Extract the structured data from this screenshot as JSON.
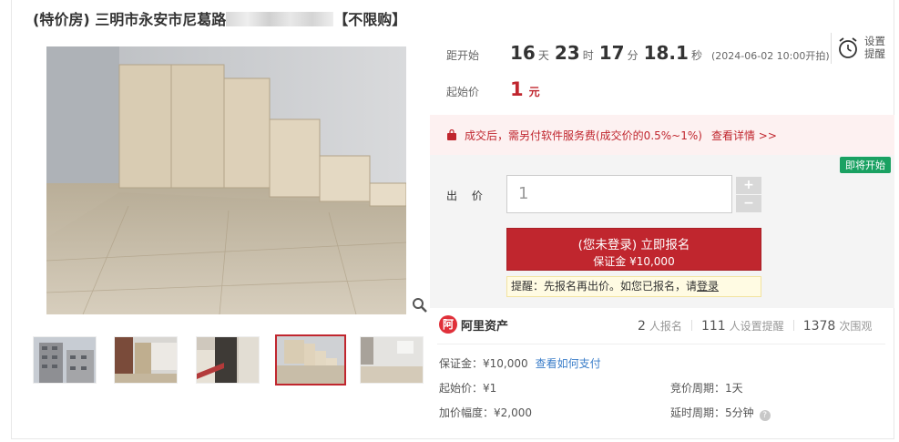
{
  "title": {
    "prefix": "(特价房) 三明市永安市尼葛路",
    "suffix": "【不限购】"
  },
  "countdown": {
    "label": "距开始",
    "days": "16",
    "days_unit": "天",
    "hours": "23",
    "hours_unit": "时",
    "minutes": "17",
    "minutes_unit": "分",
    "seconds": "18.1",
    "seconds_unit": "秒",
    "start_note": "(2024-06-02 10:00开拍)"
  },
  "reminder": {
    "label": "设置提醒",
    "icon": "alarm-clock-icon"
  },
  "start_price": {
    "label": "起始价",
    "value": "1",
    "unit": "元"
  },
  "fee_notice": {
    "text": "成交后，需另付软件服务费(成交价的0.5%~1%)",
    "link": "查看详情 >>"
  },
  "bid": {
    "badge": "即将开始",
    "label": "出 价",
    "value": "1",
    "plus": "+",
    "minus": "−",
    "signup_line1": "(您未登录) 立即报名",
    "signup_line2": "保证金 ¥10,000",
    "tip_text": "提醒：先报名再出价。如您已报名，请",
    "tip_link": "登录"
  },
  "platform": {
    "logo_char": "阿",
    "name": "阿里资产"
  },
  "stats": {
    "signups_num": "2",
    "signups_label": "人报名",
    "reminders_num": "111",
    "reminders_label": "人设置提醒",
    "views_num": "1378",
    "views_label": "次围观"
  },
  "details": {
    "deposit": "保证金：¥10,000",
    "how_to_pay": "查看如何支付",
    "start_price": "起始价：¥1",
    "cycle": "竞价周期：1天",
    "increment": "加价幅度：¥2,000",
    "delay": "延时周期：5分钟",
    "help": "?"
  },
  "colors": {
    "accent": "#c0262e",
    "badge": "#1aa162",
    "link": "#3a7dc9"
  }
}
